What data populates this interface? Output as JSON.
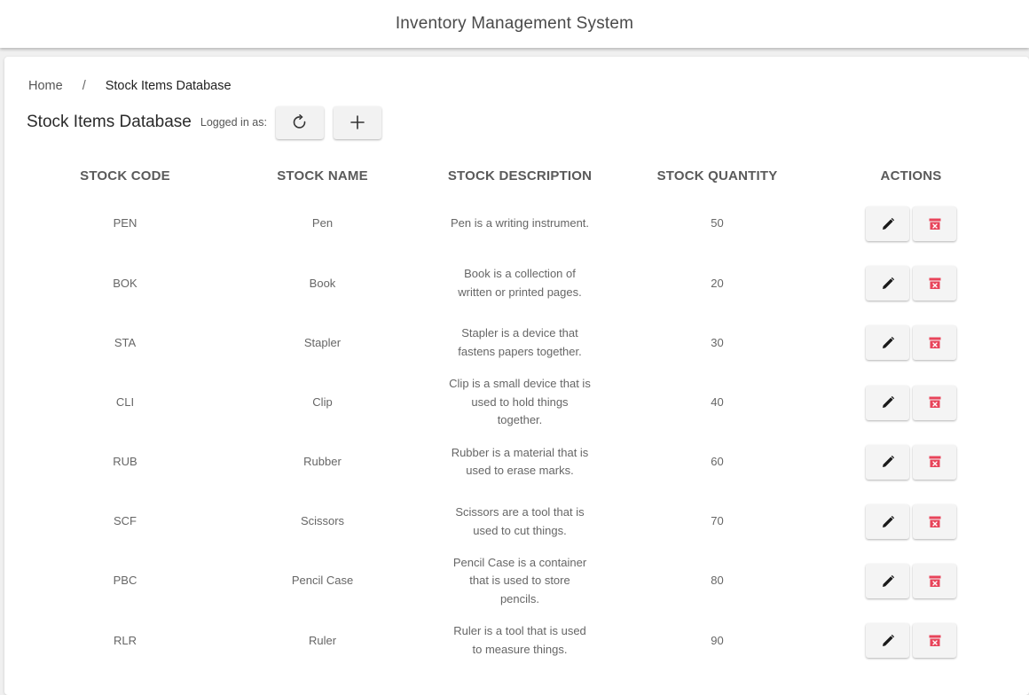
{
  "app": {
    "title": "Inventory Management System"
  },
  "breadcrumb": {
    "home": "Home",
    "separator": "/",
    "current": "Stock Items Database"
  },
  "header": {
    "title": "Stock Items Database",
    "logged_in": "Logged in as:",
    "refresh_icon": "refresh-icon",
    "add_icon": "plus-icon"
  },
  "table": {
    "columns": [
      "STOCK CODE",
      "STOCK NAME",
      "STOCK DESCRIPTION",
      "STOCK QUANTITY",
      "ACTIONS"
    ],
    "rows": [
      {
        "code": "PEN",
        "name": "Pen",
        "description": "Pen is a writing instrument.",
        "quantity": "50"
      },
      {
        "code": "BOK",
        "name": "Book",
        "description": "Book is a collection of written or printed pages.",
        "quantity": "20"
      },
      {
        "code": "STA",
        "name": "Stapler",
        "description": "Stapler is a device that fastens papers together.",
        "quantity": "30"
      },
      {
        "code": "CLI",
        "name": "Clip",
        "description": "Clip is a small device that is used to hold things together.",
        "quantity": "40"
      },
      {
        "code": "RUB",
        "name": "Rubber",
        "description": "Rubber is a material that is used to erase marks.",
        "quantity": "60"
      },
      {
        "code": "SCF",
        "name": "Scissors",
        "description": "Scissors are a tool that is used to cut things.",
        "quantity": "70"
      },
      {
        "code": "PBC",
        "name": "Pencil Case",
        "description": "Pencil Case is a container that is used to store pencils.",
        "quantity": "80"
      },
      {
        "code": "RLR",
        "name": "Ruler",
        "description": "Ruler is a tool that is used to measure things.",
        "quantity": "90"
      }
    ],
    "edit_icon": "pencil-icon",
    "delete_icon": "delete-bin-icon"
  },
  "colors": {
    "delete": "#e8445a",
    "edit": "#1a1a1a"
  }
}
